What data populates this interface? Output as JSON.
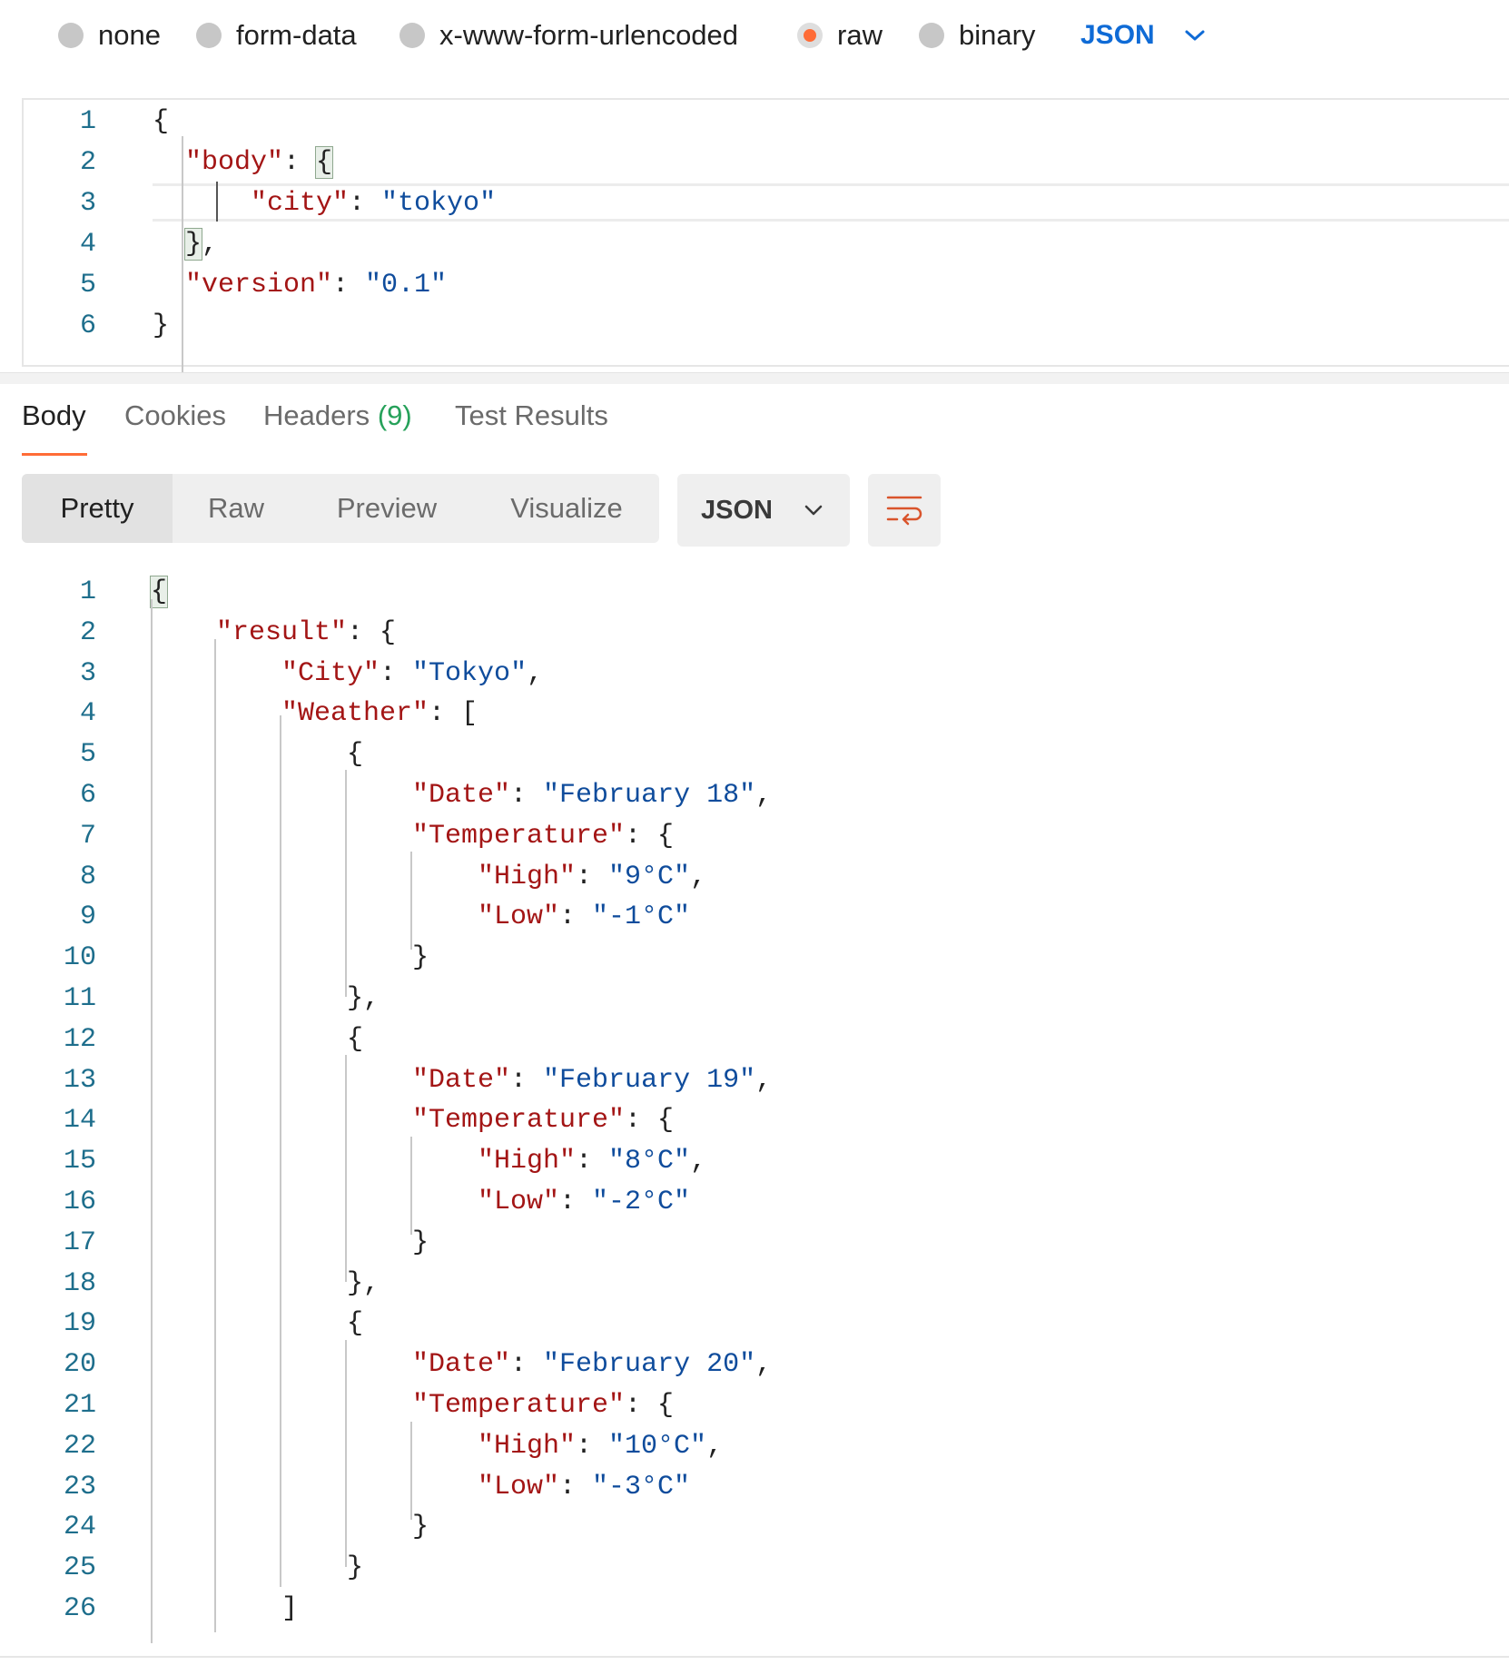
{
  "body_type": {
    "options": [
      {
        "label": "none",
        "selected": false
      },
      {
        "label": "form-data",
        "selected": false
      },
      {
        "label": "x-www-form-urlencoded",
        "selected": false
      },
      {
        "label": "raw",
        "selected": true
      },
      {
        "label": "binary",
        "selected": false
      }
    ],
    "language": "JSON"
  },
  "request_editor": {
    "lines": [
      [
        {
          "t": "p",
          "v": "{"
        }
      ],
      [
        {
          "t": "k",
          "v": "\"body\""
        },
        {
          "t": "p",
          "v": ": "
        },
        {
          "t": "bm",
          "v": "{"
        }
      ],
      [
        {
          "t": "k",
          "v": "\"city\""
        },
        {
          "t": "p",
          "v": ": "
        },
        {
          "t": "s",
          "v": "\"tokyo\""
        }
      ],
      [
        {
          "t": "bm",
          "v": "}"
        },
        {
          "t": "p",
          "v": ","
        }
      ],
      [
        {
          "t": "k",
          "v": "\"version\""
        },
        {
          "t": "p",
          "v": ": "
        },
        {
          "t": "s",
          "v": "\"0.1\""
        }
      ],
      [
        {
          "t": "p",
          "v": "}"
        }
      ]
    ]
  },
  "response": {
    "tabs": [
      {
        "label": "Body",
        "count": ""
      },
      {
        "label": "Cookies",
        "count": ""
      },
      {
        "label": "Headers",
        "count": "(9)"
      },
      {
        "label": "Test Results",
        "count": ""
      }
    ],
    "view_modes": [
      "Pretty",
      "Raw",
      "Preview",
      "Visualize"
    ],
    "format": "JSON",
    "lines": [
      [
        {
          "t": "bm",
          "v": "{"
        }
      ],
      [
        {
          "t": "k",
          "v": "\"result\""
        },
        {
          "t": "p",
          "v": ": {"
        }
      ],
      [
        {
          "t": "k",
          "v": "\"City\""
        },
        {
          "t": "p",
          "v": ": "
        },
        {
          "t": "s",
          "v": "\"Tokyo\""
        },
        {
          "t": "p",
          "v": ","
        }
      ],
      [
        {
          "t": "k",
          "v": "\"Weather\""
        },
        {
          "t": "p",
          "v": ": ["
        }
      ],
      [
        {
          "t": "p",
          "v": "{"
        }
      ],
      [
        {
          "t": "k",
          "v": "\"Date\""
        },
        {
          "t": "p",
          "v": ": "
        },
        {
          "t": "s",
          "v": "\"February 18\""
        },
        {
          "t": "p",
          "v": ","
        }
      ],
      [
        {
          "t": "k",
          "v": "\"Temperature\""
        },
        {
          "t": "p",
          "v": ": {"
        }
      ],
      [
        {
          "t": "k",
          "v": "\"High\""
        },
        {
          "t": "p",
          "v": ": "
        },
        {
          "t": "s",
          "v": "\"9°C\""
        },
        {
          "t": "p",
          "v": ","
        }
      ],
      [
        {
          "t": "k",
          "v": "\"Low\""
        },
        {
          "t": "p",
          "v": ": "
        },
        {
          "t": "s",
          "v": "\"-1°C\""
        }
      ],
      [
        {
          "t": "p",
          "v": "}"
        }
      ],
      [
        {
          "t": "p",
          "v": "},"
        }
      ],
      [
        {
          "t": "p",
          "v": "{"
        }
      ],
      [
        {
          "t": "k",
          "v": "\"Date\""
        },
        {
          "t": "p",
          "v": ": "
        },
        {
          "t": "s",
          "v": "\"February 19\""
        },
        {
          "t": "p",
          "v": ","
        }
      ],
      [
        {
          "t": "k",
          "v": "\"Temperature\""
        },
        {
          "t": "p",
          "v": ": {"
        }
      ],
      [
        {
          "t": "k",
          "v": "\"High\""
        },
        {
          "t": "p",
          "v": ": "
        },
        {
          "t": "s",
          "v": "\"8°C\""
        },
        {
          "t": "p",
          "v": ","
        }
      ],
      [
        {
          "t": "k",
          "v": "\"Low\""
        },
        {
          "t": "p",
          "v": ": "
        },
        {
          "t": "s",
          "v": "\"-2°C\""
        }
      ],
      [
        {
          "t": "p",
          "v": "}"
        }
      ],
      [
        {
          "t": "p",
          "v": "},"
        }
      ],
      [
        {
          "t": "p",
          "v": "{"
        }
      ],
      [
        {
          "t": "k",
          "v": "\"Date\""
        },
        {
          "t": "p",
          "v": ": "
        },
        {
          "t": "s",
          "v": "\"February 20\""
        },
        {
          "t": "p",
          "v": ","
        }
      ],
      [
        {
          "t": "k",
          "v": "\"Temperature\""
        },
        {
          "t": "p",
          "v": ": {"
        }
      ],
      [
        {
          "t": "k",
          "v": "\"High\""
        },
        {
          "t": "p",
          "v": ": "
        },
        {
          "t": "s",
          "v": "\"10°C\""
        },
        {
          "t": "p",
          "v": ","
        }
      ],
      [
        {
          "t": "k",
          "v": "\"Low\""
        },
        {
          "t": "p",
          "v": ": "
        },
        {
          "t": "s",
          "v": "\"-3°C\""
        }
      ],
      [
        {
          "t": "p",
          "v": "}"
        }
      ],
      [
        {
          "t": "p",
          "v": "}"
        }
      ],
      [
        {
          "t": "p",
          "v": "]"
        }
      ]
    ]
  },
  "colors": {
    "accent": "#ff6c37",
    "link": "#0f6bd6",
    "key": "#a31515",
    "string": "#0f4c9c",
    "line_number": "#1e6e8c",
    "count": "#26a15a"
  }
}
